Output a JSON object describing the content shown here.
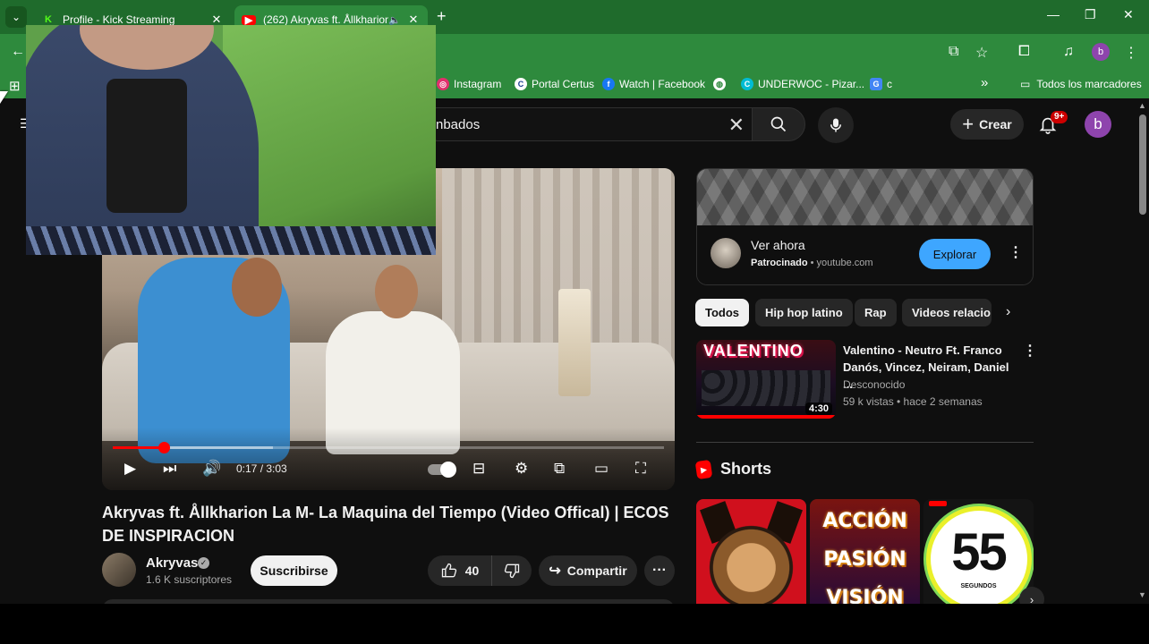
{
  "browser": {
    "tabs": [
      {
        "title": "Profile - Kick Streaming",
        "favicon": "kick-icon",
        "active": false
      },
      {
        "title": "(262) Akryvas ft. Ållkharion",
        "favicon": "youtube-icon",
        "active": true
      }
    ],
    "bookmarks": [
      {
        "label": "Instagram",
        "icon": "instagram-icon",
        "color": "#e1306c"
      },
      {
        "label": "Portal Certus",
        "icon": "certus-icon",
        "color": "#1a73e8"
      },
      {
        "label": "Watch | Facebook",
        "icon": "facebook-icon",
        "color": "#1877f2"
      },
      {
        "label": "",
        "icon": "globe-icon",
        "color": "#ffffff"
      },
      {
        "label": "UNDERWOC - Pizar...",
        "icon": "underwoc-icon",
        "color": "#00bcd4"
      },
      {
        "label": "c",
        "icon": "google-translate-icon",
        "color": "#4285f4"
      }
    ],
    "all_bookmarks_label": "Todos los marcadores",
    "profile_initial": "b",
    "theme_color": "#2e8a3d"
  },
  "youtube": {
    "search_text": "nbados",
    "create_label": "Crear",
    "notifications_badge": "9+",
    "avatar_initial": "b",
    "player": {
      "time": "0:17 / 3:03",
      "progress": 0.093,
      "buffered": 0.29
    },
    "video": {
      "title": "Akryvas ft. Ållkharion La M- La Maquina del Tiempo (Video Offical) | ECOS DE INSPIRACION",
      "channel": "Akryvas",
      "subscribers": "1.6 K suscriptores",
      "subscribe_label": "Suscribirse",
      "likes": "40",
      "share_label": "Compartir"
    },
    "ad": {
      "title": "Ver ahora",
      "sponsored_label": "Patrocinado",
      "domain": "youtube.com",
      "explore_label": "Explorar"
    },
    "chips": [
      "Todos",
      "Hip hop latino",
      "Rap",
      "Videos relacio"
    ],
    "related": {
      "thumb_text": "VALENTINO",
      "duration": "4:30",
      "title": "Valentino - Neutro Ft. Franco Danós, Vincez, Neiram, Daniel ...",
      "channel": "Desconocido",
      "meta": "59 k vistas • hace 2 semanas"
    },
    "shorts": {
      "heading": "Shorts",
      "items": [
        {
          "words": []
        },
        {
          "words": [
            "ACCIÓN",
            "PASIÓN",
            "VISIÓN"
          ]
        },
        {
          "number": "55",
          "caption": "SEGUNDOS"
        }
      ]
    }
  }
}
